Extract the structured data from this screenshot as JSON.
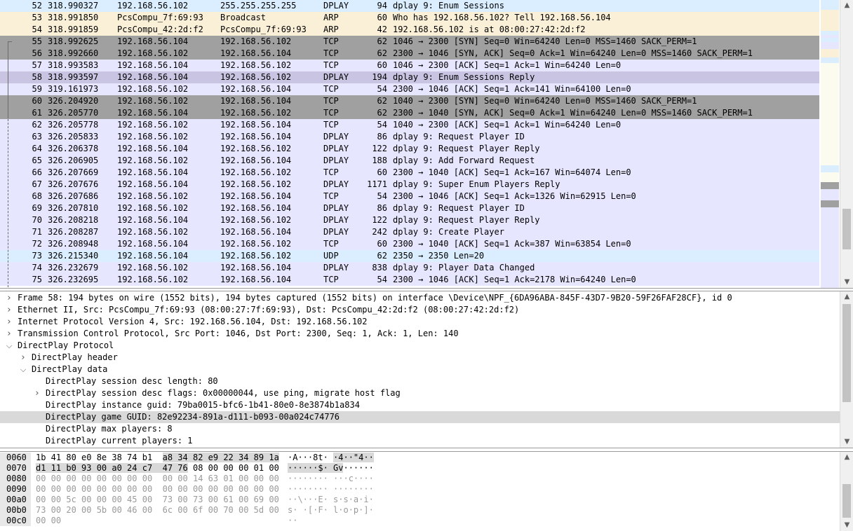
{
  "colors": {
    "udp_bg": "#daeeff",
    "arp_bg": "#faf0d7",
    "tcp_bg": "#e7e6ff",
    "syn_bg": "#a0a0a0",
    "selected_bg": "#c8c4e2"
  },
  "packets": [
    {
      "no": "52",
      "time": "318.990327",
      "src": "192.168.56.102",
      "dst": "255.255.255.255",
      "proto": "DPLAY",
      "len": "94",
      "info": "dplay 9: Enum Sessions",
      "kind": "udp"
    },
    {
      "no": "53",
      "time": "318.991850",
      "src": "PcsCompu_7f:69:93",
      "dst": "Broadcast",
      "proto": "ARP",
      "len": "60",
      "info": "Who has 192.168.56.102? Tell 192.168.56.104",
      "kind": "arp"
    },
    {
      "no": "54",
      "time": "318.991859",
      "src": "PcsCompu_42:2d:f2",
      "dst": "PcsCompu_7f:69:93",
      "proto": "ARP",
      "len": "42",
      "info": "192.168.56.102 is at 08:00:27:42:2d:f2",
      "kind": "arp"
    },
    {
      "no": "55",
      "time": "318.992625",
      "src": "192.168.56.104",
      "dst": "192.168.56.102",
      "proto": "TCP",
      "len": "62",
      "info": "1046 → 2300 [SYN] Seq=0 Win=64240 Len=0 MSS=1460 SACK_PERM=1",
      "kind": "syn"
    },
    {
      "no": "56",
      "time": "318.992660",
      "src": "192.168.56.102",
      "dst": "192.168.56.104",
      "proto": "TCP",
      "len": "62",
      "info": "2300 → 1046 [SYN, ACK] Seq=0 Ack=1 Win=64240 Len=0 MSS=1460 SACK_PERM=1",
      "kind": "syn"
    },
    {
      "no": "57",
      "time": "318.993583",
      "src": "192.168.56.104",
      "dst": "192.168.56.102",
      "proto": "TCP",
      "len": "60",
      "info": "1046 → 2300 [ACK] Seq=1 Ack=1 Win=64240 Len=0",
      "kind": "tcp"
    },
    {
      "no": "58",
      "time": "318.993597",
      "src": "192.168.56.104",
      "dst": "192.168.56.102",
      "proto": "DPLAY",
      "len": "194",
      "info": "dplay 9: Enum Sessions Reply",
      "kind": "selected"
    },
    {
      "no": "59",
      "time": "319.161973",
      "src": "192.168.56.102",
      "dst": "192.168.56.104",
      "proto": "TCP",
      "len": "54",
      "info": "2300 → 1046 [ACK] Seq=1 Ack=141 Win=64100 Len=0",
      "kind": "tcp"
    },
    {
      "no": "60",
      "time": "326.204920",
      "src": "192.168.56.102",
      "dst": "192.168.56.104",
      "proto": "TCP",
      "len": "62",
      "info": "1040 → 2300 [SYN] Seq=0 Win=64240 Len=0 MSS=1460 SACK_PERM=1",
      "kind": "syn"
    },
    {
      "no": "61",
      "time": "326.205770",
      "src": "192.168.56.104",
      "dst": "192.168.56.102",
      "proto": "TCP",
      "len": "62",
      "info": "2300 → 1040 [SYN, ACK] Seq=0 Ack=1 Win=64240 Len=0 MSS=1460 SACK_PERM=1",
      "kind": "syn"
    },
    {
      "no": "62",
      "time": "326.205778",
      "src": "192.168.56.102",
      "dst": "192.168.56.104",
      "proto": "TCP",
      "len": "54",
      "info": "1040 → 2300 [ACK] Seq=1 Ack=1 Win=64240 Len=0",
      "kind": "tcp"
    },
    {
      "no": "63",
      "time": "326.205833",
      "src": "192.168.56.102",
      "dst": "192.168.56.104",
      "proto": "DPLAY",
      "len": "86",
      "info": "dplay 9: Request Player ID",
      "kind": "tcp"
    },
    {
      "no": "64",
      "time": "326.206378",
      "src": "192.168.56.104",
      "dst": "192.168.56.102",
      "proto": "DPLAY",
      "len": "122",
      "info": "dplay 9: Request Player Reply",
      "kind": "tcp"
    },
    {
      "no": "65",
      "time": "326.206905",
      "src": "192.168.56.102",
      "dst": "192.168.56.104",
      "proto": "DPLAY",
      "len": "188",
      "info": "dplay 9: Add Forward Request",
      "kind": "tcp"
    },
    {
      "no": "66",
      "time": "326.207669",
      "src": "192.168.56.104",
      "dst": "192.168.56.102",
      "proto": "TCP",
      "len": "60",
      "info": "2300 → 1040 [ACK] Seq=1 Ack=167 Win=64074 Len=0",
      "kind": "tcp"
    },
    {
      "no": "67",
      "time": "326.207676",
      "src": "192.168.56.104",
      "dst": "192.168.56.102",
      "proto": "DPLAY",
      "len": "1171",
      "info": "dplay 9: Super Enum Players Reply",
      "kind": "tcp"
    },
    {
      "no": "68",
      "time": "326.207686",
      "src": "192.168.56.102",
      "dst": "192.168.56.104",
      "proto": "TCP",
      "len": "54",
      "info": "2300 → 1046 [ACK] Seq=1 Ack=1326 Win=62915 Len=0",
      "kind": "tcp"
    },
    {
      "no": "69",
      "time": "326.207810",
      "src": "192.168.56.102",
      "dst": "192.168.56.104",
      "proto": "DPLAY",
      "len": "86",
      "info": "dplay 9: Request Player ID",
      "kind": "tcp"
    },
    {
      "no": "70",
      "time": "326.208218",
      "src": "192.168.56.104",
      "dst": "192.168.56.102",
      "proto": "DPLAY",
      "len": "122",
      "info": "dplay 9: Request Player Reply",
      "kind": "tcp"
    },
    {
      "no": "71",
      "time": "326.208287",
      "src": "192.168.56.102",
      "dst": "192.168.56.104",
      "proto": "DPLAY",
      "len": "242",
      "info": "dplay 9: Create Player",
      "kind": "tcp"
    },
    {
      "no": "72",
      "time": "326.208948",
      "src": "192.168.56.104",
      "dst": "192.168.56.102",
      "proto": "TCP",
      "len": "60",
      "info": "2300 → 1040 [ACK] Seq=1 Ack=387 Win=63854 Len=0",
      "kind": "tcp"
    },
    {
      "no": "73",
      "time": "326.215340",
      "src": "192.168.56.104",
      "dst": "192.168.56.102",
      "proto": "UDP",
      "len": "62",
      "info": "2350 → 2350 Len=20",
      "kind": "udp"
    },
    {
      "no": "74",
      "time": "326.232679",
      "src": "192.168.56.102",
      "dst": "192.168.56.104",
      "proto": "DPLAY",
      "len": "838",
      "info": "dplay 9: Player Data Changed",
      "kind": "tcp"
    },
    {
      "no": "75",
      "time": "326.232695",
      "src": "192.168.56.102",
      "dst": "192.168.56.104",
      "proto": "TCP",
      "len": "54",
      "info": "2300 → 1046 [ACK] Seq=1 Ack=2178 Win=64240 Len=0",
      "kind": "tcp"
    }
  ],
  "details": [
    {
      "text": "Frame 58: 194 bytes on wire (1552 bits), 194 bytes captured (1552 bits) on interface \\Device\\NPF_{6DA96ABA-845F-43D7-9B20-59F26FAF28CF}, id 0",
      "level": 0,
      "toggle": "collapsed"
    },
    {
      "text": "Ethernet II, Src: PcsCompu_7f:69:93 (08:00:27:7f:69:93), Dst: PcsCompu_42:2d:f2 (08:00:27:42:2d:f2)",
      "level": 0,
      "toggle": "collapsed"
    },
    {
      "text": "Internet Protocol Version 4, Src: 192.168.56.104, Dst: 192.168.56.102",
      "level": 0,
      "toggle": "collapsed"
    },
    {
      "text": "Transmission Control Protocol, Src Port: 1046, Dst Port: 2300, Seq: 1, Ack: 1, Len: 140",
      "level": 0,
      "toggle": "collapsed"
    },
    {
      "text": "DirectPlay Protocol",
      "level": 0,
      "toggle": "expanded"
    },
    {
      "text": "DirectPlay header",
      "level": 1,
      "toggle": "collapsed"
    },
    {
      "text": "DirectPlay data",
      "level": 1,
      "toggle": "expanded"
    },
    {
      "text": "DirectPlay session desc length: 80",
      "level": 2,
      "toggle": "none"
    },
    {
      "text": "DirectPlay session desc flags: 0x00000044, use ping, migrate host flag",
      "level": 2,
      "toggle": "collapsed"
    },
    {
      "text": "DirectPlay instance guid: 79ba0015-bfc6-1b41-80e0-8e3874b1a834",
      "level": 2,
      "toggle": "none"
    },
    {
      "text": "DirectPlay game GUID: 82e92234-891a-d111-b093-00a024c74776",
      "level": 2,
      "toggle": "none",
      "selected": true
    },
    {
      "text": "DirectPlay max players: 8",
      "level": 2,
      "toggle": "none"
    },
    {
      "text": "DirectPlay current players: 1",
      "level": 2,
      "toggle": "none"
    }
  ],
  "bytes": [
    {
      "offset": "0060",
      "hex_a": "1b 41 80 e0 8e 38 74 b1",
      "hex_b": "a8 34 82 e9 22 34 89 1a",
      "ascii_a": "·A···8t·",
      "ascii_b": "·4··\"4··",
      "hl_b": true,
      "hl_ascii_b": true,
      "dim": false
    },
    {
      "offset": "0070",
      "hex_a": "d1 11 b0 93 00 a0 24 c7",
      "hex_b": "47 76 08 00 00 00 01 00",
      "ascii_a": "······$·",
      "ascii_b": "Gv······",
      "hl_a": true,
      "hl_b_part": "47 76",
      "hl_ascii_a": true,
      "hl_ascii_b_part": "Gv",
      "dim": false
    },
    {
      "offset": "0080",
      "hex_a": "00 00 00 00 00 00 00 00",
      "hex_b": "00 00 14 63 01 00 00 00",
      "ascii_a": "········",
      "ascii_b": "···c····",
      "dim": true
    },
    {
      "offset": "0090",
      "hex_a": "00 00 00 00 00 00 00 00",
      "hex_b": "00 00 00 00 00 00 00 00",
      "ascii_a": "········",
      "ascii_b": "········",
      "dim": true
    },
    {
      "offset": "00a0",
      "hex_a": "00 00 5c 00 00 00 45 00",
      "hex_b": "73 00 73 00 61 00 69 00",
      "ascii_a": "··\\···E·",
      "ascii_b": "s·s·a·i·",
      "dim": true
    },
    {
      "offset": "00b0",
      "hex_a": "73 00 20 00 5b 00 46 00",
      "hex_b": "6c 00 6f 00 70 00 5d 00",
      "ascii_a": "s· ·[·F·",
      "ascii_b": "l·o·p·]·",
      "dim": true
    },
    {
      "offset": "00c0",
      "hex_a": "00 00",
      "hex_b": "",
      "ascii_a": "··",
      "ascii_b": "",
      "dim": true
    }
  ],
  "scroll_icons": {
    "up": "▲",
    "down": "▼"
  }
}
